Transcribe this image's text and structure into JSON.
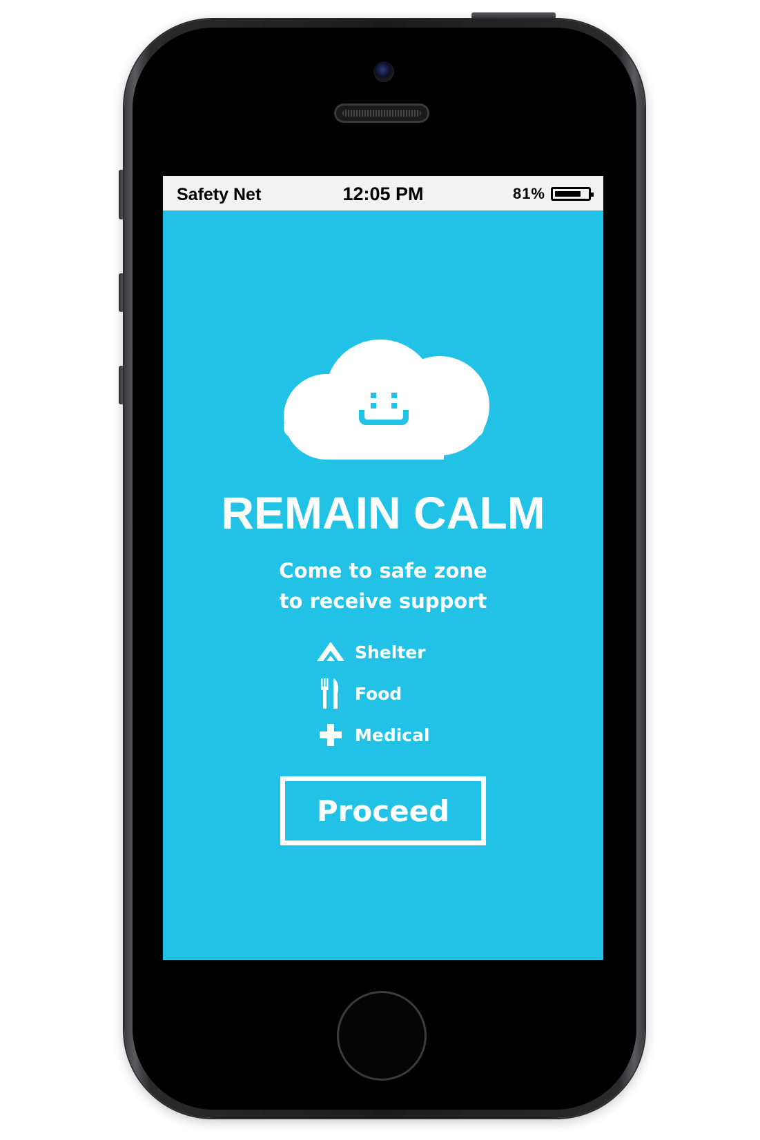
{
  "status_bar": {
    "carrier": "Safety Net",
    "time": "12:05 PM",
    "battery_percent": "81%",
    "battery_level": 0.81
  },
  "main": {
    "illustration_icon": "smiling-cloud-icon",
    "headline": "REMAIN CALM",
    "subtitle_line1": "Come to safe zone",
    "subtitle_line2": "to receive support",
    "features": [
      {
        "icon": "shelter-icon",
        "label": "Shelter"
      },
      {
        "icon": "fork-knife-icon",
        "label": "Food"
      },
      {
        "icon": "medical-cross-icon",
        "label": "Medical"
      }
    ],
    "proceed_label": "Proceed"
  },
  "colors": {
    "screen_background": "#22c2e6",
    "status_bar_background": "#f2f2f2",
    "foreground": "#ffffff"
  }
}
